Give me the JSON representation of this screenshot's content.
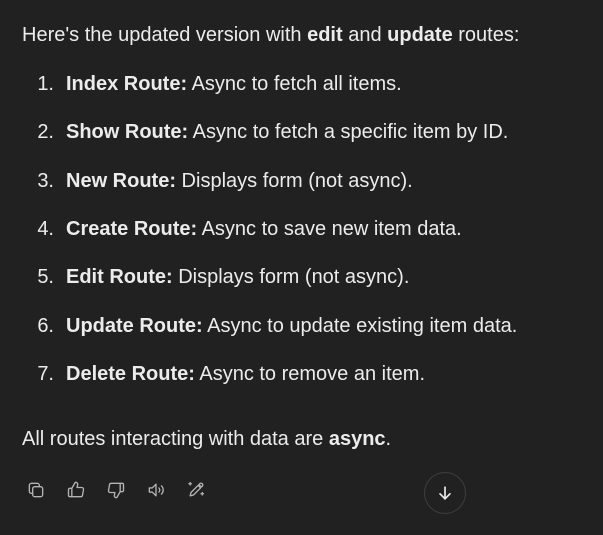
{
  "message": {
    "intro": {
      "before": "Here's the updated version with ",
      "bold1": "edit",
      "middle": " and ",
      "bold2": "update",
      "after": " routes:"
    },
    "routes": [
      {
        "num": "1.",
        "title": "Index Route:",
        "desc": " Async to fetch all items."
      },
      {
        "num": "2.",
        "title": "Show Route:",
        "desc": " Async to fetch a specific item by ID."
      },
      {
        "num": "3.",
        "title": "New Route:",
        "desc": " Displays form (not async)."
      },
      {
        "num": "4.",
        "title": "Create Route:",
        "desc": " Async to save new item data."
      },
      {
        "num": "5.",
        "title": "Edit Route:",
        "desc": " Displays form (not async)."
      },
      {
        "num": "6.",
        "title": "Update Route:",
        "desc": " Async to update existing item data."
      },
      {
        "num": "7.",
        "title": "Delete Route:",
        "desc": " Async to remove an item."
      }
    ],
    "outro": {
      "before": "All routes interacting with data are ",
      "bold": "async",
      "after": "."
    }
  },
  "actions": [
    {
      "icon": "copy-icon"
    },
    {
      "icon": "thumbs-up-icon"
    },
    {
      "icon": "thumbs-down-icon"
    },
    {
      "icon": "read-aloud-icon"
    },
    {
      "icon": "edit-pen-icon"
    }
  ],
  "scroll_button": {
    "icon": "arrow-down-icon"
  },
  "colors": {
    "background": "#212121",
    "text": "#ececec",
    "icon": "#b4b4b4",
    "border": "#3e3e3e"
  }
}
